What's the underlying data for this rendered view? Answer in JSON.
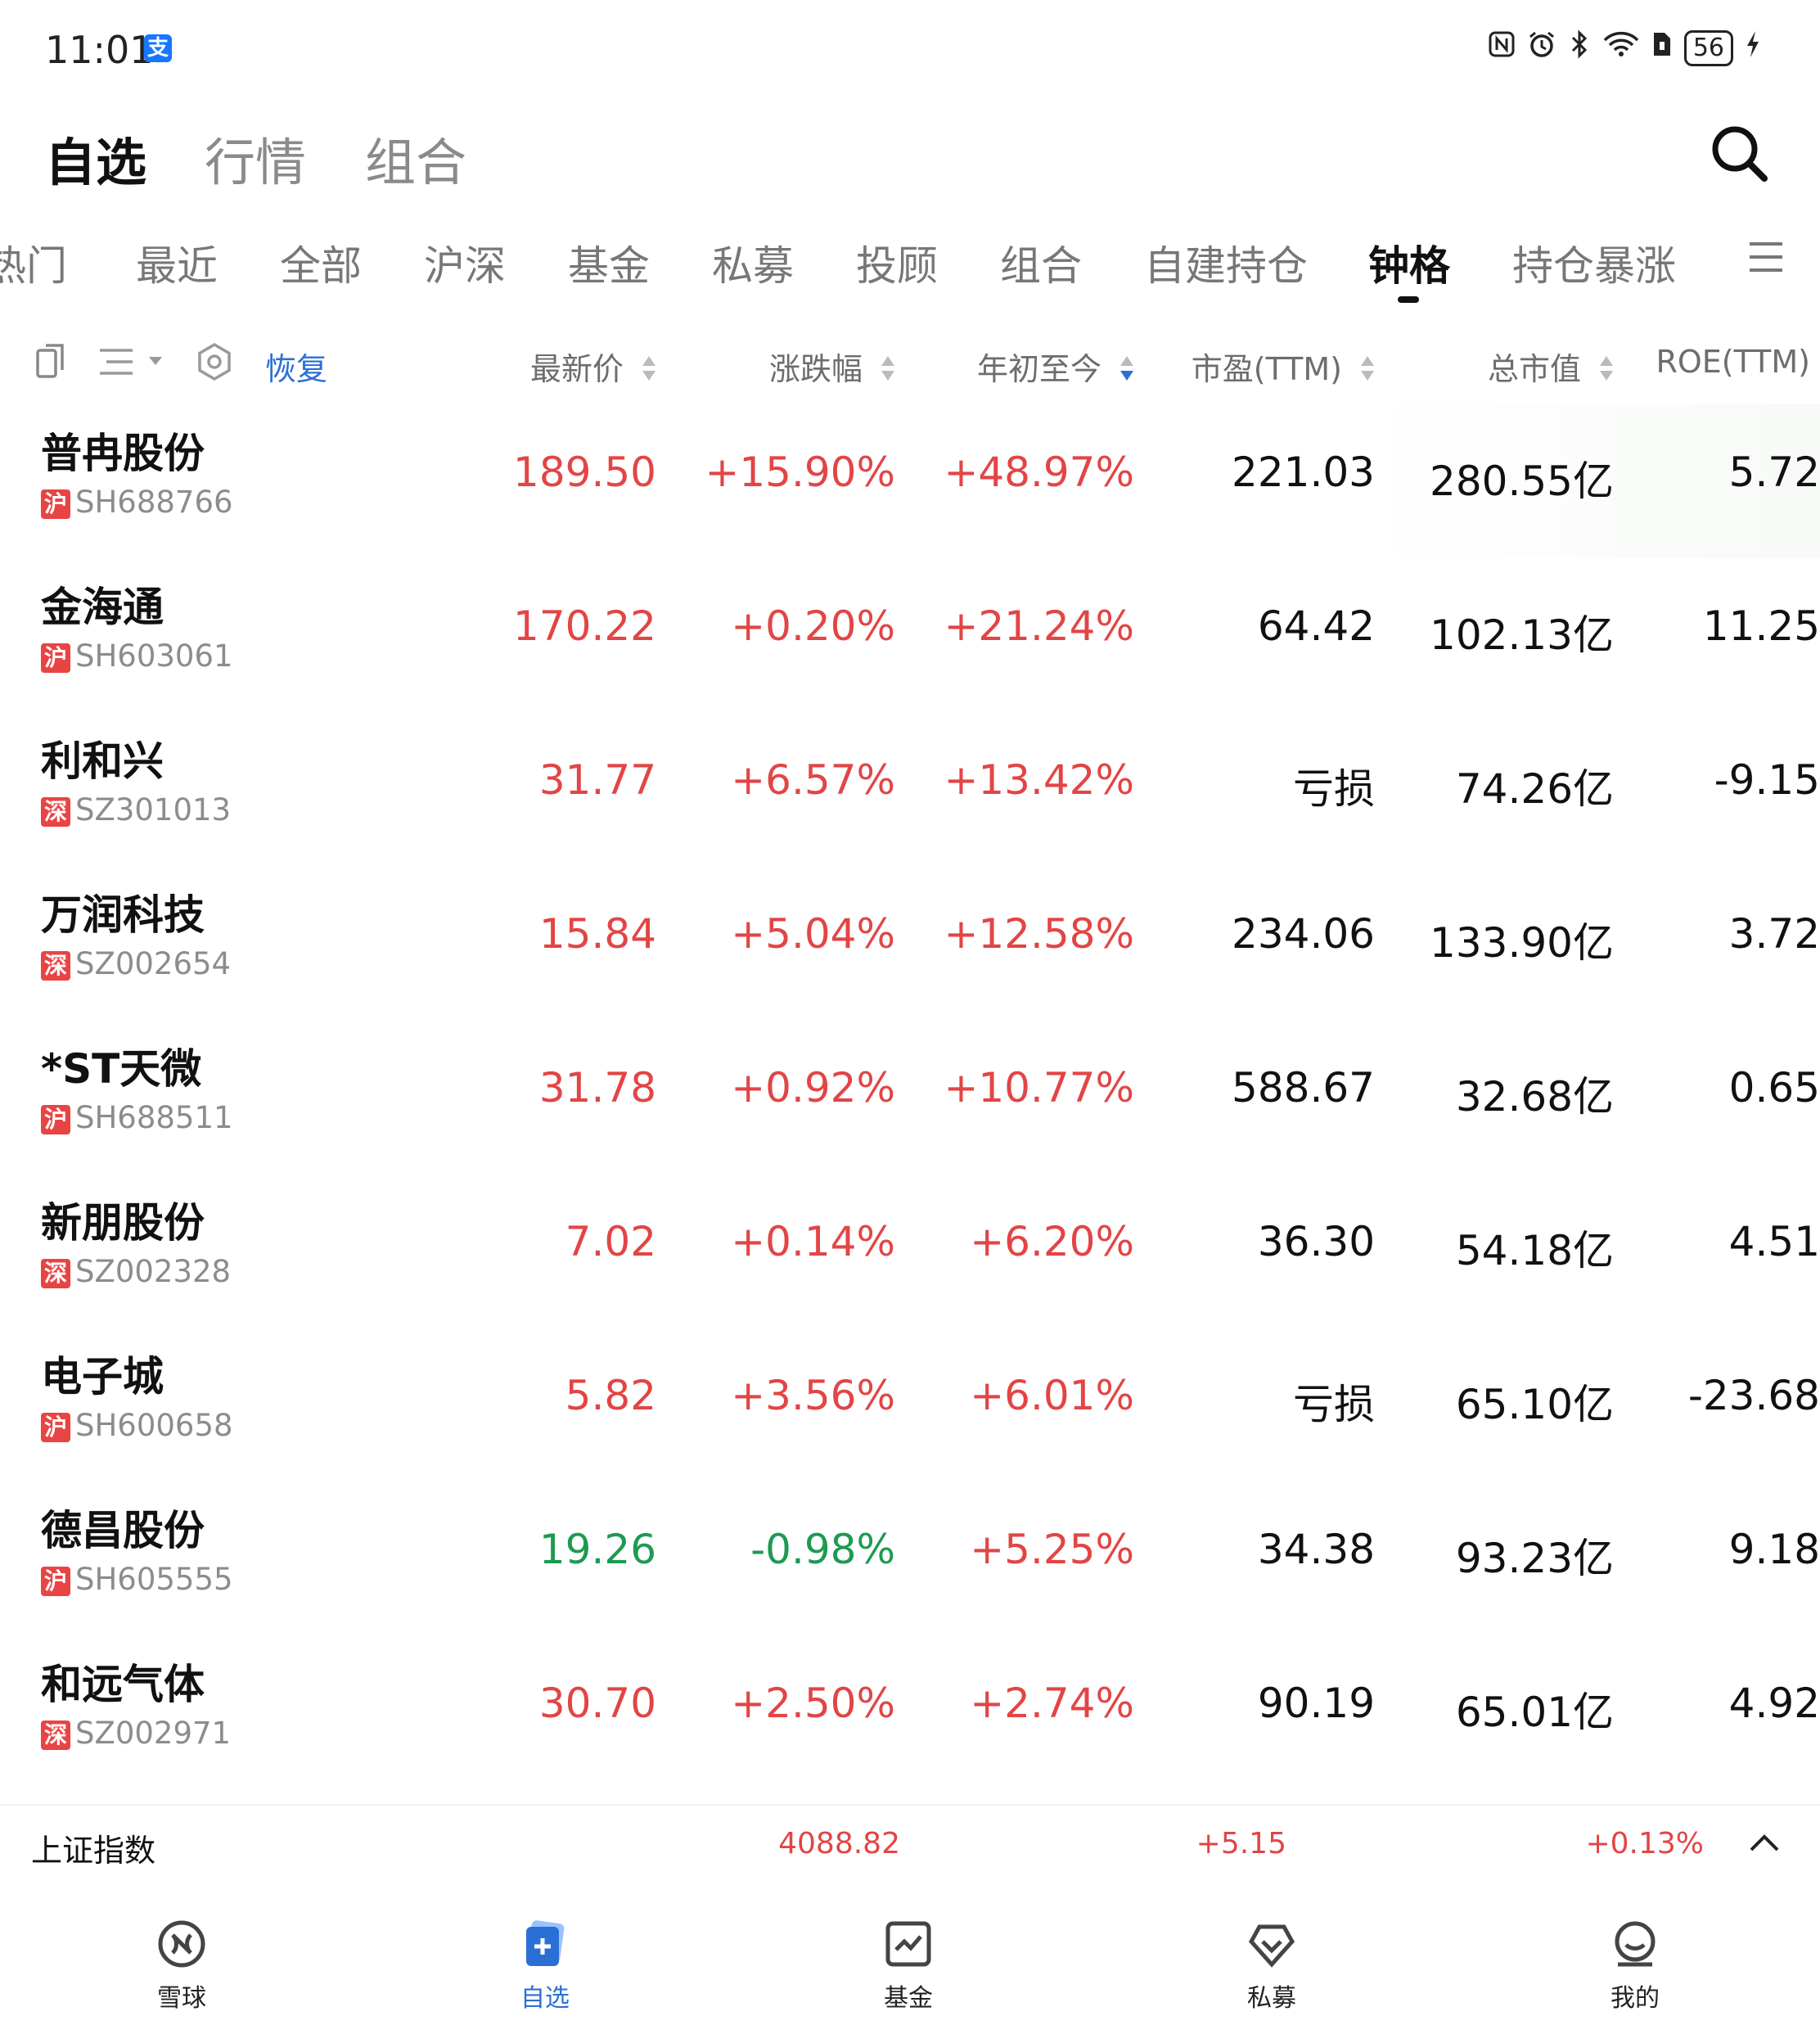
{
  "status_bar": {
    "time": "11:01",
    "alipay_badge": "支",
    "battery": "56"
  },
  "header_tabs": [
    {
      "label": "自选",
      "active": true
    },
    {
      "label": "行情",
      "active": false
    },
    {
      "label": "组合",
      "active": false
    }
  ],
  "category_tabs": [
    {
      "label": "热门"
    },
    {
      "label": "最近"
    },
    {
      "label": "全部"
    },
    {
      "label": "沪深"
    },
    {
      "label": "基金"
    },
    {
      "label": "私募"
    },
    {
      "label": "投顾"
    },
    {
      "label": "组合"
    },
    {
      "label": "自建持仓"
    },
    {
      "label": "钟格",
      "active": true
    },
    {
      "label": "持仓暴涨"
    }
  ],
  "toolbar": {
    "restore_label": "恢复"
  },
  "columns": {
    "price": "最新价",
    "change": "涨跌幅",
    "ytd": "年初至今",
    "pe": "市盈(TTM)",
    "cap": "总市值",
    "roe": "ROE(TTM)"
  },
  "rows": [
    {
      "name": "普冉股份",
      "market": "沪",
      "code": "SH688766",
      "price": "189.50",
      "change": "+15.90%",
      "ytd": "+48.97%",
      "pe": "221.03",
      "cap": "280.55亿",
      "roe": "5.72",
      "dir": "up"
    },
    {
      "name": "金海通",
      "market": "沪",
      "code": "SH603061",
      "price": "170.22",
      "change": "+0.20%",
      "ytd": "+21.24%",
      "pe": "64.42",
      "cap": "102.13亿",
      "roe": "11.25",
      "dir": "up"
    },
    {
      "name": "利和兴",
      "market": "深",
      "code": "SZ301013",
      "price": "31.77",
      "change": "+6.57%",
      "ytd": "+13.42%",
      "pe": "亏损",
      "cap": "74.26亿",
      "roe": "-9.15",
      "dir": "up"
    },
    {
      "name": "万润科技",
      "market": "深",
      "code": "SZ002654",
      "price": "15.84",
      "change": "+5.04%",
      "ytd": "+12.58%",
      "pe": "234.06",
      "cap": "133.90亿",
      "roe": "3.72",
      "dir": "up"
    },
    {
      "name": "*ST天微",
      "market": "沪",
      "code": "SH688511",
      "price": "31.78",
      "change": "+0.92%",
      "ytd": "+10.77%",
      "pe": "588.67",
      "cap": "32.68亿",
      "roe": "0.65",
      "dir": "up"
    },
    {
      "name": "新朋股份",
      "market": "深",
      "code": "SZ002328",
      "price": "7.02",
      "change": "+0.14%",
      "ytd": "+6.20%",
      "pe": "36.30",
      "cap": "54.18亿",
      "roe": "4.51",
      "dir": "up"
    },
    {
      "name": "电子城",
      "market": "沪",
      "code": "SH600658",
      "price": "5.82",
      "change": "+3.56%",
      "ytd": "+6.01%",
      "pe": "亏损",
      "cap": "65.10亿",
      "roe": "-23.68",
      "dir": "up"
    },
    {
      "name": "德昌股份",
      "market": "沪",
      "code": "SH605555",
      "price": "19.26",
      "change": "-0.98%",
      "ytd": "+5.25%",
      "pe": "34.38",
      "cap": "93.23亿",
      "roe": "9.18",
      "dir": "down"
    },
    {
      "name": "和远气体",
      "market": "深",
      "code": "SZ002971",
      "price": "30.70",
      "change": "+2.50%",
      "ytd": "+2.74%",
      "pe": "90.19",
      "cap": "65.01亿",
      "roe": "4.92",
      "dir": "up"
    }
  ],
  "index_bar": {
    "name": "上证指数",
    "value": "4088.82",
    "change": "+5.15",
    "percent": "+0.13%"
  },
  "bottom_nav": [
    {
      "label": "雪球",
      "icon": "xueqiu-icon"
    },
    {
      "label": "自选",
      "icon": "watchlist-icon",
      "active": true
    },
    {
      "label": "基金",
      "icon": "fund-icon"
    },
    {
      "label": "私募",
      "icon": "private-fund-icon"
    },
    {
      "label": "我的",
      "icon": "profile-icon"
    }
  ],
  "colors": {
    "up": "#e24545",
    "down": "#1d9a52",
    "accent": "#2a6fd6"
  }
}
